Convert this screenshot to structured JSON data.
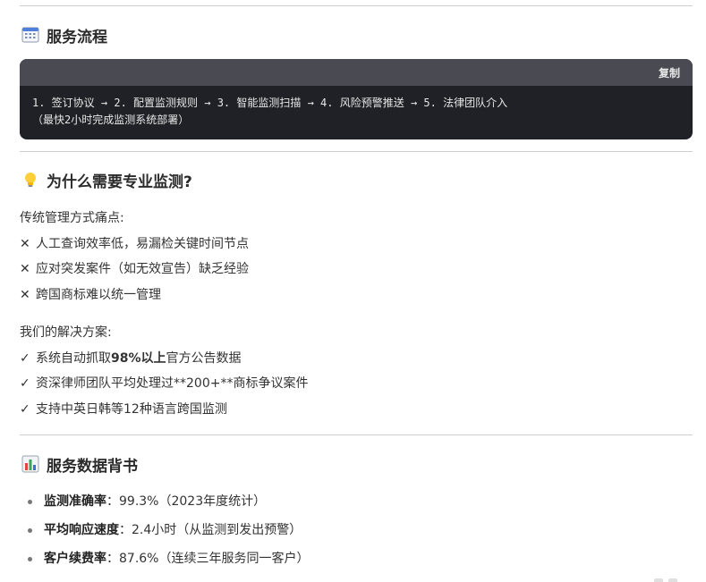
{
  "sections": {
    "process": {
      "icon": "calendar-icon",
      "title": "服务流程",
      "code": {
        "copy_label": "复制",
        "line1": "1. 签订协议 → 2. 配置监测规则 → 3. 智能监测扫描 → 4. 风险预警推送 → 5. 法律团队介入",
        "line2": "（最快2小时完成监测系统部署）"
      }
    },
    "why": {
      "icon": "lightbulb-icon",
      "title": "为什么需要专业监测?",
      "pain_title": "传统管理方式痛点:",
      "pain_mark": "✕",
      "pains": [
        "人工查询效率低，易漏检关键时间节点",
        "应对突发案件（如无效宣告）缺乏经验",
        "跨国商标难以统一管理"
      ],
      "solution_title": "我们的解决方案:",
      "solution_mark": "✓",
      "solution1_before": "系统自动抓取",
      "solution1_bold": "98%以上",
      "solution1_after": "官方公告数据",
      "solution2": "资深律师团队平均处理过**200+**商标争议案件",
      "solution3": "支持中英日韩等12种语言跨国监测"
    },
    "stats": {
      "icon": "bar-chart-icon",
      "title": "服务数据背书",
      "items": [
        {
          "label": "监测准确率",
          "sep": "：",
          "value": "99.3%（2023年度统计）"
        },
        {
          "label": "平均响应速度",
          "sep": "：",
          "value": "2.4小时（从监测到发出预警）"
        },
        {
          "label": "客户续费率",
          "sep": "：",
          "value": "87.6%（连续三年服务同一客户）"
        }
      ]
    }
  },
  "colors": {
    "code_bg": "#1f2126",
    "code_bar": "#4a4b52",
    "divider": "#cfcfcf"
  }
}
